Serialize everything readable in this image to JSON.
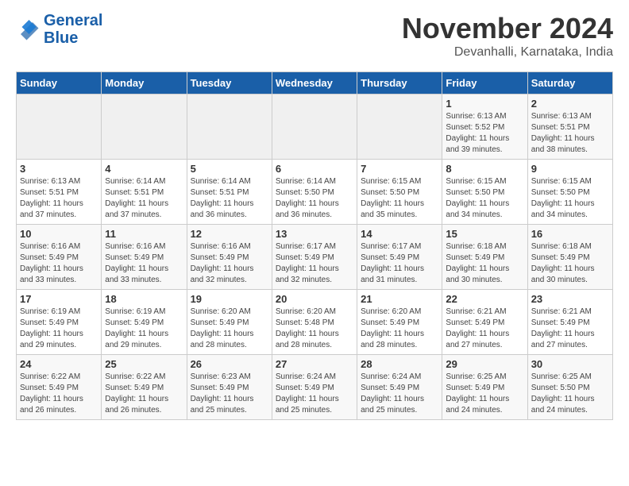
{
  "header": {
    "logo_line1": "General",
    "logo_line2": "Blue",
    "month": "November 2024",
    "location": "Devanhalli, Karnataka, India"
  },
  "weekdays": [
    "Sunday",
    "Monday",
    "Tuesday",
    "Wednesday",
    "Thursday",
    "Friday",
    "Saturday"
  ],
  "weeks": [
    [
      {
        "day": "",
        "info": ""
      },
      {
        "day": "",
        "info": ""
      },
      {
        "day": "",
        "info": ""
      },
      {
        "day": "",
        "info": ""
      },
      {
        "day": "",
        "info": ""
      },
      {
        "day": "1",
        "info": "Sunrise: 6:13 AM\nSunset: 5:52 PM\nDaylight: 11 hours\nand 39 minutes."
      },
      {
        "day": "2",
        "info": "Sunrise: 6:13 AM\nSunset: 5:51 PM\nDaylight: 11 hours\nand 38 minutes."
      }
    ],
    [
      {
        "day": "3",
        "info": "Sunrise: 6:13 AM\nSunset: 5:51 PM\nDaylight: 11 hours\nand 37 minutes."
      },
      {
        "day": "4",
        "info": "Sunrise: 6:14 AM\nSunset: 5:51 PM\nDaylight: 11 hours\nand 37 minutes."
      },
      {
        "day": "5",
        "info": "Sunrise: 6:14 AM\nSunset: 5:51 PM\nDaylight: 11 hours\nand 36 minutes."
      },
      {
        "day": "6",
        "info": "Sunrise: 6:14 AM\nSunset: 5:50 PM\nDaylight: 11 hours\nand 36 minutes."
      },
      {
        "day": "7",
        "info": "Sunrise: 6:15 AM\nSunset: 5:50 PM\nDaylight: 11 hours\nand 35 minutes."
      },
      {
        "day": "8",
        "info": "Sunrise: 6:15 AM\nSunset: 5:50 PM\nDaylight: 11 hours\nand 34 minutes."
      },
      {
        "day": "9",
        "info": "Sunrise: 6:15 AM\nSunset: 5:50 PM\nDaylight: 11 hours\nand 34 minutes."
      }
    ],
    [
      {
        "day": "10",
        "info": "Sunrise: 6:16 AM\nSunset: 5:49 PM\nDaylight: 11 hours\nand 33 minutes."
      },
      {
        "day": "11",
        "info": "Sunrise: 6:16 AM\nSunset: 5:49 PM\nDaylight: 11 hours\nand 33 minutes."
      },
      {
        "day": "12",
        "info": "Sunrise: 6:16 AM\nSunset: 5:49 PM\nDaylight: 11 hours\nand 32 minutes."
      },
      {
        "day": "13",
        "info": "Sunrise: 6:17 AM\nSunset: 5:49 PM\nDaylight: 11 hours\nand 32 minutes."
      },
      {
        "day": "14",
        "info": "Sunrise: 6:17 AM\nSunset: 5:49 PM\nDaylight: 11 hours\nand 31 minutes."
      },
      {
        "day": "15",
        "info": "Sunrise: 6:18 AM\nSunset: 5:49 PM\nDaylight: 11 hours\nand 30 minutes."
      },
      {
        "day": "16",
        "info": "Sunrise: 6:18 AM\nSunset: 5:49 PM\nDaylight: 11 hours\nand 30 minutes."
      }
    ],
    [
      {
        "day": "17",
        "info": "Sunrise: 6:19 AM\nSunset: 5:49 PM\nDaylight: 11 hours\nand 29 minutes."
      },
      {
        "day": "18",
        "info": "Sunrise: 6:19 AM\nSunset: 5:49 PM\nDaylight: 11 hours\nand 29 minutes."
      },
      {
        "day": "19",
        "info": "Sunrise: 6:20 AM\nSunset: 5:49 PM\nDaylight: 11 hours\nand 28 minutes."
      },
      {
        "day": "20",
        "info": "Sunrise: 6:20 AM\nSunset: 5:48 PM\nDaylight: 11 hours\nand 28 minutes."
      },
      {
        "day": "21",
        "info": "Sunrise: 6:20 AM\nSunset: 5:49 PM\nDaylight: 11 hours\nand 28 minutes."
      },
      {
        "day": "22",
        "info": "Sunrise: 6:21 AM\nSunset: 5:49 PM\nDaylight: 11 hours\nand 27 minutes."
      },
      {
        "day": "23",
        "info": "Sunrise: 6:21 AM\nSunset: 5:49 PM\nDaylight: 11 hours\nand 27 minutes."
      }
    ],
    [
      {
        "day": "24",
        "info": "Sunrise: 6:22 AM\nSunset: 5:49 PM\nDaylight: 11 hours\nand 26 minutes."
      },
      {
        "day": "25",
        "info": "Sunrise: 6:22 AM\nSunset: 5:49 PM\nDaylight: 11 hours\nand 26 minutes."
      },
      {
        "day": "26",
        "info": "Sunrise: 6:23 AM\nSunset: 5:49 PM\nDaylight: 11 hours\nand 25 minutes."
      },
      {
        "day": "27",
        "info": "Sunrise: 6:24 AM\nSunset: 5:49 PM\nDaylight: 11 hours\nand 25 minutes."
      },
      {
        "day": "28",
        "info": "Sunrise: 6:24 AM\nSunset: 5:49 PM\nDaylight: 11 hours\nand 25 minutes."
      },
      {
        "day": "29",
        "info": "Sunrise: 6:25 AM\nSunset: 5:49 PM\nDaylight: 11 hours\nand 24 minutes."
      },
      {
        "day": "30",
        "info": "Sunrise: 6:25 AM\nSunset: 5:50 PM\nDaylight: 11 hours\nand 24 minutes."
      }
    ]
  ]
}
